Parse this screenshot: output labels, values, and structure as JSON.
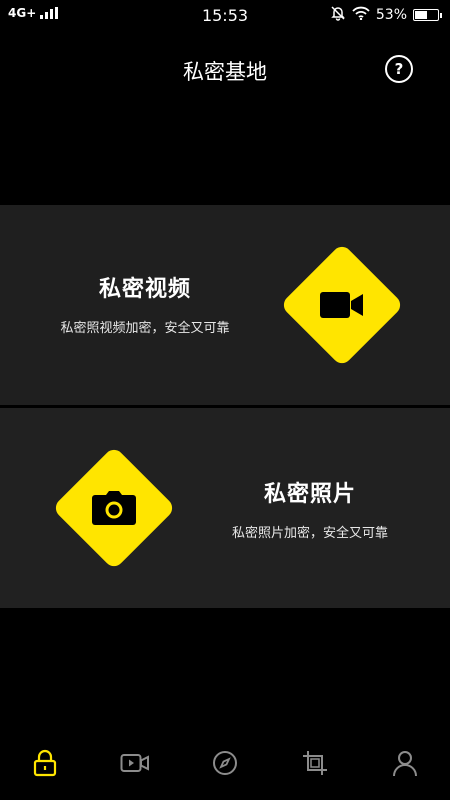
{
  "status_bar": {
    "network": "4G+",
    "time": "15:53",
    "battery_percent_label": "53%",
    "battery_level": 0.53
  },
  "header": {
    "title": "私密基地",
    "help_label": "?"
  },
  "cards": {
    "video": {
      "title": "私密视频",
      "subtitle": "私密照视频加密，安全又可靠",
      "icon": "video-camera-icon"
    },
    "photo": {
      "title": "私密照片",
      "subtitle": "私密照片加密，安全又可靠",
      "icon": "camera-icon"
    }
  },
  "tab_bar": {
    "items": [
      {
        "icon": "lock-icon",
        "active": true
      },
      {
        "icon": "video-icon",
        "active": false
      },
      {
        "icon": "compass-icon",
        "active": false
      },
      {
        "icon": "crop-icon",
        "active": false
      },
      {
        "icon": "profile-icon",
        "active": false
      }
    ]
  },
  "colors": {
    "accent": "#ffe500",
    "background": "#000000",
    "card": "#1f1f1f",
    "inactive_icon": "#8c8c8c"
  }
}
